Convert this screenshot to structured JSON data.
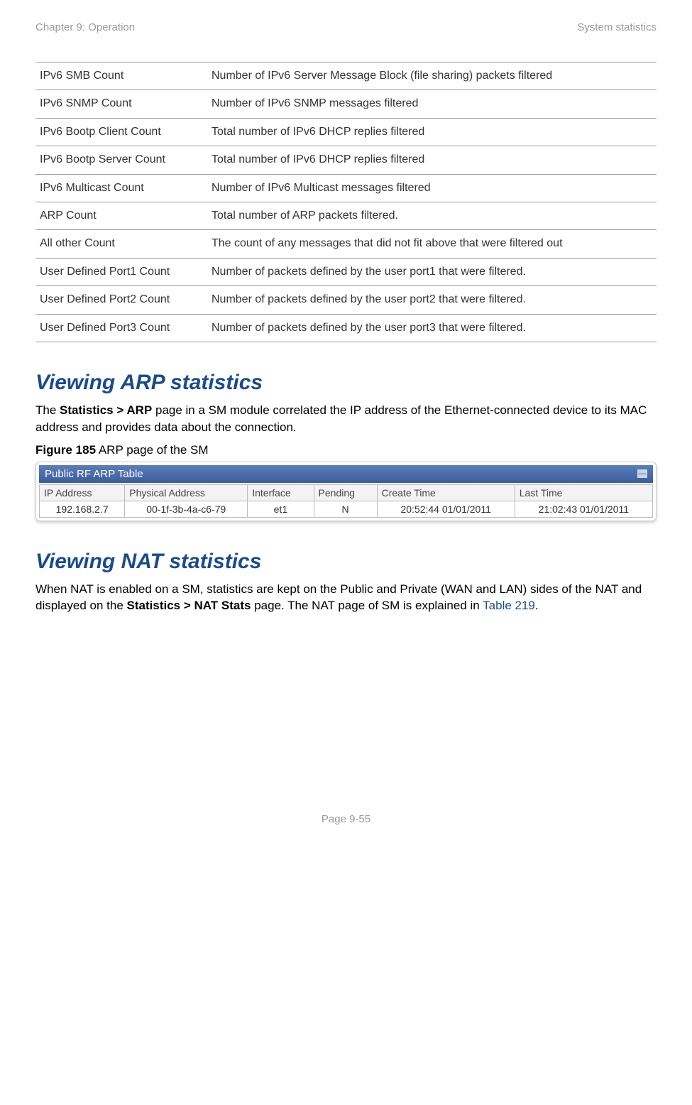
{
  "header": {
    "left": "Chapter 9:  Operation",
    "right": "System statistics"
  },
  "stats_table": [
    {
      "name": "IPv6 SMB Count",
      "desc": "Number of IPv6 Server Message Block (file sharing) packets filtered"
    },
    {
      "name": "IPv6 SNMP Count",
      "desc": "Number of IPv6 SNMP messages filtered"
    },
    {
      "name": "IPv6 Bootp Client Count",
      "desc": "Total number of IPv6 DHCP replies filtered"
    },
    {
      "name": "IPv6 Bootp Server Count",
      "desc": "Total number of IPv6 DHCP replies filtered"
    },
    {
      "name": "IPv6 Multicast Count",
      "desc": "Number of IPv6 Multicast messages filtered"
    },
    {
      "name": "ARP Count",
      "desc": "Total number of ARP packets filtered."
    },
    {
      "name": "All other Count",
      "desc": "The count of any messages that did not fit above that were filtered out"
    },
    {
      "name": "User Defined Port1 Count",
      "desc": "Number of packets defined by the user port1 that were filtered."
    },
    {
      "name": "User Defined Port2 Count",
      "desc": "Number of packets defined by the user port2 that were filtered."
    },
    {
      "name": "User Defined Port3 Count",
      "desc": "Number of packets defined by the user port3 that were filtered."
    }
  ],
  "arp_section": {
    "heading": "Viewing ARP statistics",
    "para_prefix": "The ",
    "para_bold": "Statistics > ARP",
    "para_suffix": " page in a SM module correlated the IP address of the Ethernet-connected device to its MAC address and provides data about the connection.",
    "figure_bold": "Figure 185",
    "figure_rest": " ARP page of the SM",
    "panel_title": "Public RF ARP Table",
    "table_headers": [
      "IP Address",
      "Physical Address",
      "Interface",
      "Pending",
      "Create Time",
      "Last Time"
    ],
    "table_row": [
      "192.168.2.7",
      "00-1f-3b-4a-c6-79",
      "et1",
      "N",
      "20:52:44 01/01/2011",
      "21:02:43 01/01/2011"
    ]
  },
  "nat_section": {
    "heading": "Viewing NAT statistics",
    "para_prefix": "When NAT is enabled on a SM, statistics are kept on the Public and Private (WAN and LAN) sides of the NAT and displayed on the ",
    "para_bold": "Statistics > NAT Stats",
    "para_mid": " page. The NAT page of SM is explained in ",
    "para_link": "Table 219",
    "para_suffix": "."
  },
  "footer": {
    "page": "Page 9-55"
  }
}
